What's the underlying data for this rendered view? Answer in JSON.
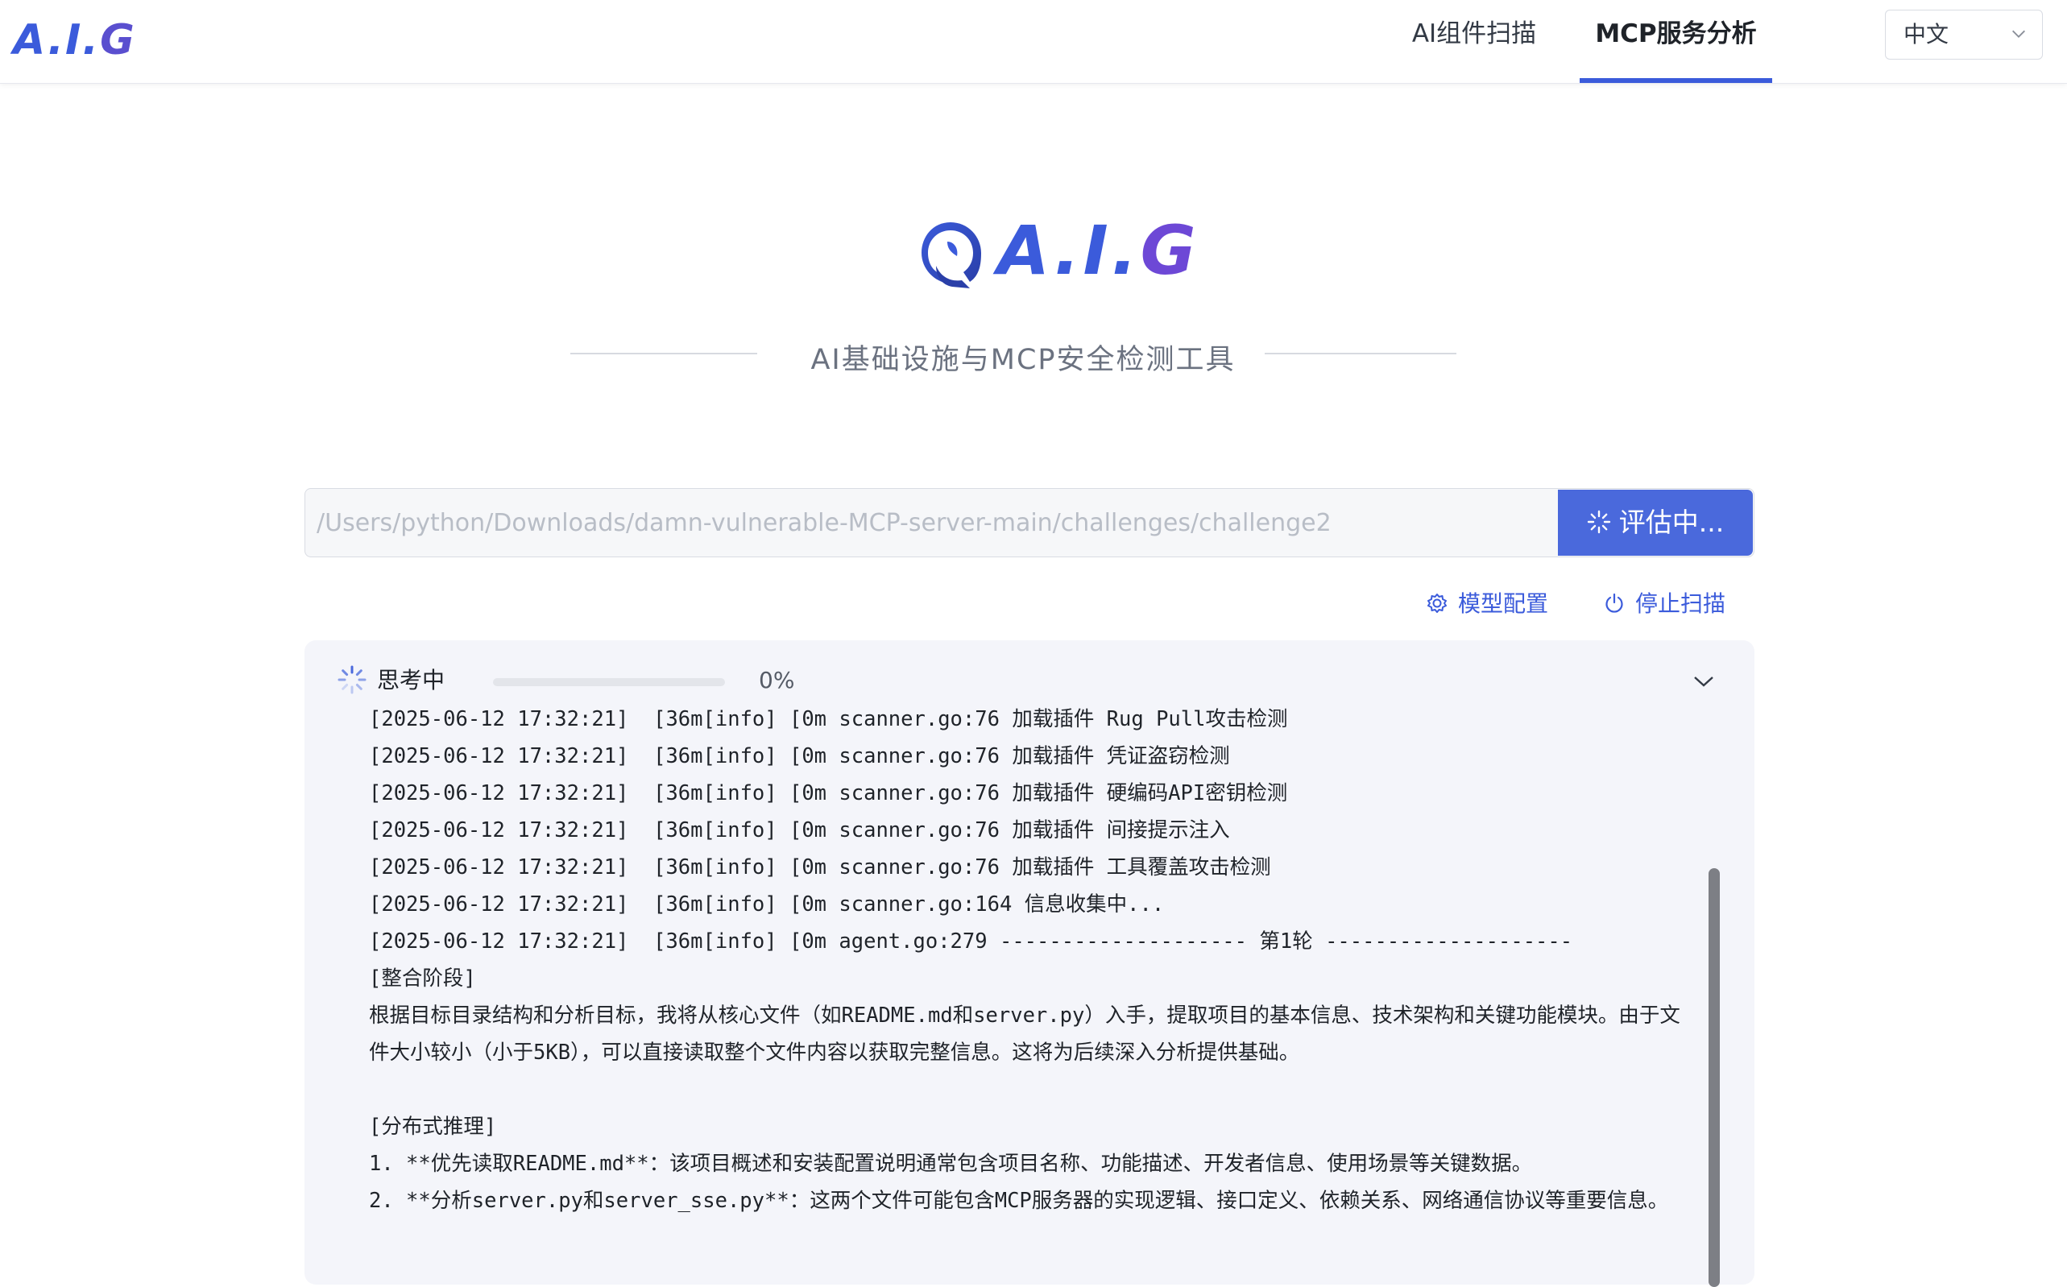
{
  "header": {
    "brand": "A.I.G",
    "nav": [
      {
        "label": "AI组件扫描",
        "active": false
      },
      {
        "label": "MCP服务分析",
        "active": true
      }
    ],
    "language": "中文"
  },
  "hero": {
    "name": "A.I.G",
    "subtitle": "AI基础设施与MCP安全检测工具"
  },
  "search": {
    "value": "/Users/python/Downloads/damn-vulnerable-MCP-server-main/challenges/challenge2",
    "button_label": "评估中..."
  },
  "actions": {
    "model_config": "模型配置",
    "stop_scan": "停止扫描"
  },
  "panel": {
    "status": "思考中",
    "progress": 0,
    "progress_text": "0%",
    "log_lines": [
      "[2025-06-12 17:32:21]  [36m[info] [0m scanner.go:76 加载插件 Rug Pull攻击检测",
      "[2025-06-12 17:32:21]  [36m[info] [0m scanner.go:76 加载插件 凭证盗窃检测",
      "[2025-06-12 17:32:21]  [36m[info] [0m scanner.go:76 加载插件 硬编码API密钥检测",
      "[2025-06-12 17:32:21]  [36m[info] [0m scanner.go:76 加载插件 间接提示注入",
      "[2025-06-12 17:32:21]  [36m[info] [0m scanner.go:76 加载插件 工具覆盖攻击检测",
      "[2025-06-12 17:32:21]  [36m[info] [0m scanner.go:164 信息收集中...",
      "[2025-06-12 17:32:21]  [36m[info] [0m agent.go:279 -------------------- 第1轮 --------------------",
      "[整合阶段]"
    ],
    "paragraph_1": "根据目标目录结构和分析目标，我将从核心文件（如README.md和server.py）入手，提取项目的基本信息、技术架构和关键功能模块。由于文件大小较小（小于5KB），可以直接读取整个文件内容以获取完整信息。这将为后续深入分析提供基础。",
    "section_2": "[分布式推理]",
    "item_1": "1. **优先读取README.md**：该项目概述和安装配置说明通常包含项目名称、功能描述、开发者信息、使用场景等关键数据。",
    "item_2": "2. **分析server.py和server_sse.py**：这两个文件可能包含MCP服务器的实现逻辑、接口定义、依赖关系、网络通信协议等重要信息。"
  },
  "colors": {
    "accent": "#4a69dc",
    "brand_gradient_end": "#6d48d6"
  }
}
